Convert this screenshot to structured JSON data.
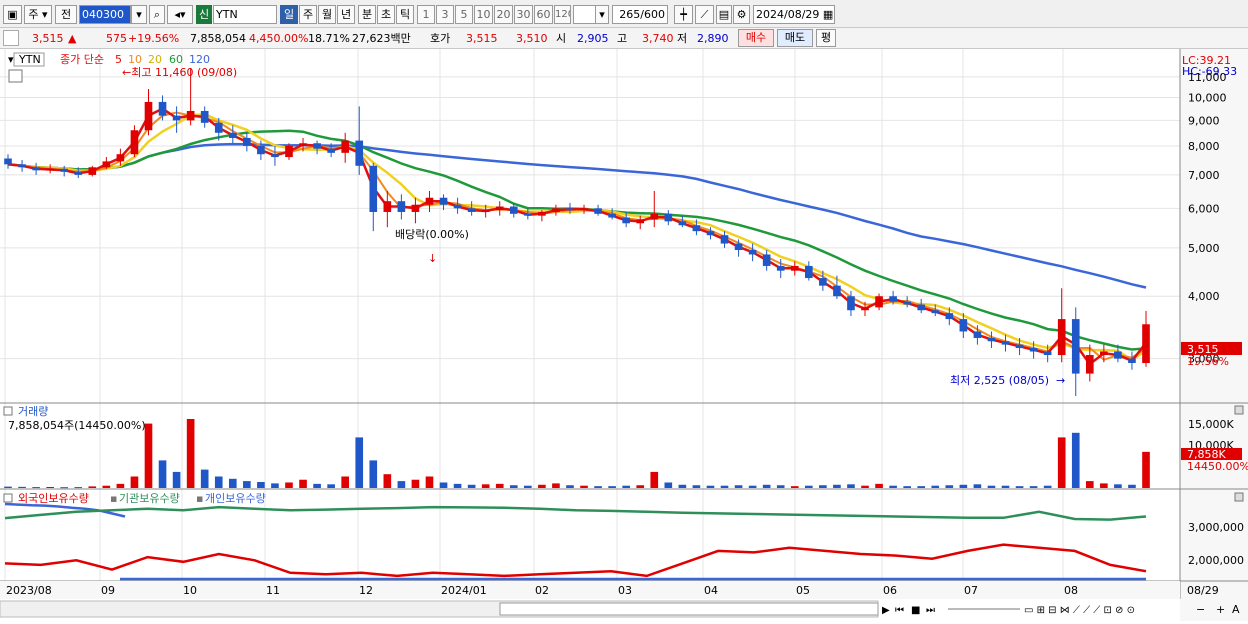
{
  "toolbar": {
    "market": "주",
    "prev": "전",
    "code": "040300",
    "name_badge": "신",
    "name": "YTN",
    "periods": [
      "일",
      "주",
      "월",
      "년",
      "분",
      "초",
      "틱"
    ],
    "selected_period": "일",
    "intervals": [
      "1",
      "3",
      "5",
      "10",
      "20",
      "30",
      "60",
      "120"
    ],
    "count": "265",
    "count_max": "/600",
    "date": "2024/08/29"
  },
  "quote": {
    "price": "3,515",
    "arrow": "▲",
    "change": "575",
    "change_pct": "+19.56%",
    "volume": "7,858,054",
    "volume_pct": "4,450.00%",
    "turnover": "18.71%",
    "amount": "27,623백만",
    "hoga_label": "호가",
    "ask": "3,515",
    "bid": "3,510",
    "open_label": "시",
    "open": "2,905",
    "high_label": "고",
    "high": "3,740",
    "low_label": "저",
    "low": "2,890",
    "buy_btn": "매수",
    "sell_btn": "매도",
    "avg_btn": "평"
  },
  "legend": {
    "stock": "YTN",
    "ma_title": "종가 단순",
    "ma_periods": [
      "5",
      "10",
      "20",
      "60",
      "120"
    ],
    "high_annot": "←최고 11,460 (09/08)",
    "low_annot": "최저 2,525 (08/05)",
    "div_annot": "배당락(0.00%)"
  },
  "right_info": {
    "lc": "LC:39.21",
    "hc": "HC:-69.33",
    "last_price": "3,515",
    "last_pct": "19.56%",
    "last_vol": "7,858K",
    "vol_pct": "14450.00%"
  },
  "volume_panel": {
    "title": "거래량",
    "value": "7,858,054주(14450.00%)"
  },
  "holdings_panel": {
    "foreign": "외국인보유수량",
    "inst": "기관보유수량",
    "indiv": "개인보유수량"
  },
  "colors": {
    "up": "#e00000",
    "down": "#1f57c8",
    "ma5": "#e01010",
    "ma10": "#f08a20",
    "ma20": "#f0d020",
    "ma60": "#1f9a3a",
    "ma120": "#3a66d8"
  },
  "chart_data": [
    {
      "type": "candlestick",
      "title": "YTN",
      "y_ticks": [
        3000,
        4000,
        5000,
        6000,
        7000,
        8000,
        9000,
        10000,
        11000
      ],
      "ylim": [
        2525,
        11460
      ],
      "x_ticks": [
        "2023/08",
        "09",
        "10",
        "11",
        "12",
        "2024/01",
        "02",
        "03",
        "04",
        "05",
        "06",
        "07",
        "08",
        "08/29"
      ],
      "ohlc": [
        [
          7550,
          7700,
          7200,
          7350
        ],
        [
          7350,
          7500,
          7100,
          7250
        ],
        [
          7250,
          7400,
          7000,
          7150
        ],
        [
          7150,
          7350,
          7050,
          7200
        ],
        [
          7200,
          7300,
          6950,
          7100
        ],
        [
          7100,
          7250,
          6900,
          7000
        ],
        [
          7000,
          7300,
          6950,
          7250
        ],
        [
          7250,
          7600,
          7200,
          7450
        ],
        [
          7450,
          7900,
          7300,
          7700
        ],
        [
          7700,
          8800,
          7600,
          8600
        ],
        [
          8600,
          10400,
          8400,
          9800
        ],
        [
          9800,
          10100,
          9000,
          9200
        ],
        [
          9200,
          9600,
          8500,
          9000
        ],
        [
          9000,
          11460,
          8800,
          9400
        ],
        [
          9400,
          9600,
          8700,
          8900
        ],
        [
          8900,
          9100,
          8200,
          8500
        ],
        [
          8500,
          8800,
          8100,
          8300
        ],
        [
          8300,
          8500,
          7800,
          8000
        ],
        [
          8000,
          8200,
          7500,
          7700
        ],
        [
          7700,
          8000,
          7300,
          7600
        ],
        [
          7600,
          8100,
          7500,
          8000
        ],
        [
          8000,
          8300,
          7800,
          8100
        ],
        [
          8100,
          8200,
          7700,
          7900
        ],
        [
          7900,
          8100,
          7600,
          7750
        ],
        [
          7750,
          8500,
          7400,
          8200
        ],
        [
          8200,
          9600,
          7000,
          7300
        ],
        [
          7300,
          7400,
          5400,
          5900
        ],
        [
          5900,
          6500,
          5500,
          6200
        ],
        [
          6200,
          6400,
          5700,
          5900
        ],
        [
          5900,
          6300,
          5600,
          6100
        ],
        [
          6100,
          6500,
          5900,
          6300
        ],
        [
          6300,
          6400,
          5950,
          6100
        ],
        [
          6100,
          6300,
          5850,
          6000
        ],
        [
          6000,
          6200,
          5800,
          5900
        ],
        [
          5900,
          6100,
          5750,
          5950
        ],
        [
          5950,
          6200,
          5800,
          6050
        ],
        [
          6050,
          6150,
          5750,
          5850
        ],
        [
          5850,
          6000,
          5700,
          5800
        ],
        [
          5800,
          5950,
          5650,
          5900
        ],
        [
          5900,
          6100,
          5800,
          6000
        ],
        [
          6000,
          6150,
          5850,
          5950
        ],
        [
          5950,
          6100,
          5850,
          6000
        ],
        [
          6000,
          6100,
          5800,
          5850
        ],
        [
          5850,
          6000,
          5700,
          5750
        ],
        [
          5750,
          5900,
          5500,
          5600
        ],
        [
          5600,
          5800,
          5450,
          5700
        ],
        [
          5700,
          6500,
          5500,
          5850
        ],
        [
          5850,
          5950,
          5550,
          5650
        ],
        [
          5650,
          5800,
          5500,
          5550
        ],
        [
          5550,
          5700,
          5300,
          5400
        ],
        [
          5400,
          5500,
          5200,
          5300
        ],
        [
          5300,
          5400,
          5000,
          5100
        ],
        [
          5100,
          5200,
          4800,
          4950
        ],
        [
          4950,
          5100,
          4700,
          4850
        ],
        [
          4850,
          4950,
          4500,
          4600
        ],
        [
          4600,
          4750,
          4350,
          4500
        ],
        [
          4500,
          4700,
          4400,
          4600
        ],
        [
          4600,
          4700,
          4300,
          4350
        ],
        [
          4350,
          4500,
          4100,
          4200
        ],
        [
          4200,
          4400,
          3950,
          4000
        ],
        [
          4000,
          4100,
          3650,
          3750
        ],
        [
          3750,
          3900,
          3650,
          3800
        ],
        [
          3800,
          4050,
          3750,
          4000
        ],
        [
          4000,
          4100,
          3850,
          3900
        ],
        [
          3900,
          4000,
          3800,
          3850
        ],
        [
          3850,
          3950,
          3700,
          3750
        ],
        [
          3750,
          3850,
          3650,
          3700
        ],
        [
          3700,
          3800,
          3500,
          3600
        ],
        [
          3600,
          3700,
          3300,
          3400
        ],
        [
          3400,
          3500,
          3200,
          3300
        ],
        [
          3300,
          3400,
          3150,
          3250
        ],
        [
          3250,
          3350,
          3100,
          3200
        ],
        [
          3200,
          3300,
          3050,
          3150
        ],
        [
          3150,
          3250,
          3000,
          3100
        ],
        [
          3100,
          3200,
          2950,
          3050
        ],
        [
          3050,
          4150,
          2950,
          3600
        ],
        [
          3600,
          3800,
          2525,
          2800
        ],
        [
          2800,
          3200,
          2700,
          3050
        ],
        [
          3050,
          3200,
          2950,
          3100
        ],
        [
          3100,
          3200,
          2950,
          3000
        ],
        [
          3000,
          3100,
          2850,
          2940
        ],
        [
          2940,
          3740,
          2890,
          3515
        ]
      ],
      "volume": [
        300,
        250,
        200,
        220,
        180,
        200,
        350,
        500,
        900,
        2500,
        14000,
        6000,
        3500,
        15000,
        4000,
        2500,
        2000,
        1500,
        1300,
        1000,
        1200,
        1800,
        900,
        800,
        2500,
        11000,
        6000,
        3000,
        1500,
        1800,
        2500,
        1200,
        900,
        700,
        800,
        900,
        600,
        500,
        700,
        1000,
        600,
        500,
        400,
        400,
        500,
        600,
        3500,
        1200,
        700,
        600,
        500,
        500,
        600,
        500,
        700,
        600,
        400,
        500,
        600,
        700,
        800,
        500,
        900,
        500,
        400,
        400,
        500,
        600,
        700,
        800,
        500,
        500,
        400,
        400,
        500,
        11000,
        12000,
        1500,
        1000,
        800,
        700,
        7858
      ],
      "foreign_holdings": [
        2000000,
        1950000,
        2100000,
        1800000,
        2200000,
        2050000,
        2300000,
        2100000,
        1700000,
        1650000,
        1700000,
        1600000,
        1700000,
        1650000,
        1600000,
        1650000,
        1700000,
        1750000,
        1600000,
        2000000,
        2400000,
        2350000,
        2500000,
        2400000,
        2300000,
        2250000,
        2150000,
        2400000,
        2600000,
        2500000,
        2400000,
        1950000,
        1750000
      ],
      "institution_holdings": [
        3450000,
        3550000,
        3650000,
        3700000,
        3750000,
        3700000,
        3800000,
        3750000,
        3700000,
        3720000,
        3750000,
        3770000,
        3800000,
        3790000,
        3780000,
        3750000,
        3700000,
        3680000,
        3650000,
        3620000,
        3600000,
        3580000,
        3560000,
        3540000,
        3520000,
        3500000,
        3480000,
        3460000,
        3460000,
        3650000,
        3420000,
        3400000,
        3500000
      ],
      "individual_holdings": [
        3900000,
        3880000,
        3860000,
        3850000,
        3820000,
        3780000,
        3750000,
        3700000,
        3600000,
        3500000
      ]
    }
  ]
}
